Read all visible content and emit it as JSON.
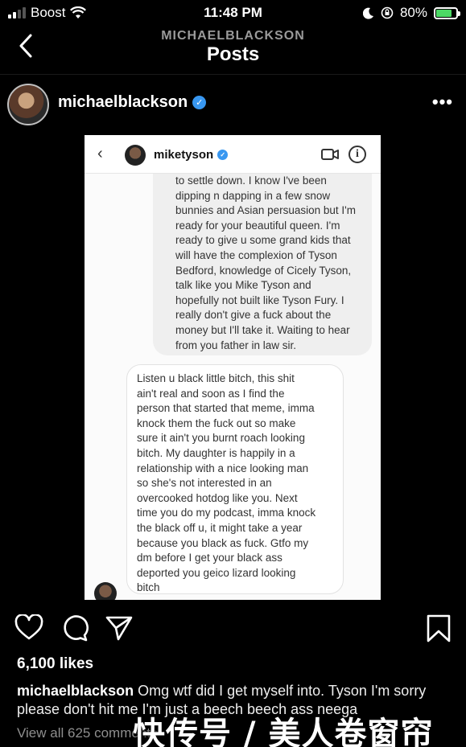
{
  "status_bar": {
    "carrier": "Boost",
    "time": "11:48 PM",
    "battery": "80%",
    "battery_level": 0.8
  },
  "header": {
    "account": "MICHAELBLACKSON",
    "title": "Posts"
  },
  "post": {
    "username": "michaelblackson",
    "more": "•••",
    "embedded": {
      "username": "miketyson",
      "info_icon": "i",
      "message_received": [
        "to settle down. I know I've been",
        "dipping n dapping in a few snow",
        "bunnies and Asian persuasion but I'm",
        "ready for your beautiful queen. I'm",
        "ready to give u some grand kids that",
        "will have the complexion of Tyson",
        "Bedford, knowledge of Cicely Tyson,",
        "talk like you Mike Tyson and",
        "hopefully not built like Tyson Fury. I",
        "really don't give a fuck about the",
        "money but I'll take it. Waiting to hear",
        "from you father in law sir."
      ],
      "message_reply": [
        "Listen u black little bitch, this shit",
        "ain't real and soon as I find the",
        "person that started that meme, imma",
        "knock them the fuck out so make",
        "sure it ain't you burnt roach looking",
        "bitch. My daughter is happily in a",
        "relationship with a nice looking man",
        "so she's not interested in an",
        "overcooked hotdog like you. Next",
        "time you do my podcast, imma knock",
        "the black off u, it might take a year",
        "because you black as fuck. Gtfo my",
        "dm before I get your black ass",
        "deported you geico lizard looking",
        "bitch"
      ]
    },
    "likes": "6,100 likes",
    "caption_user": "michaelblackson",
    "caption_text": "Omg wtf did I get myself into. Tyson I'm sorry please don't hit me I'm just a beech beech ass neega",
    "view_comments": "View all 625 comments"
  },
  "watermark": "快传号 / 美人卷窗帘",
  "colors": {
    "background": "#000000",
    "verified": "#3897f0",
    "battery_fill": "#4cd964",
    "muted": "#8e8e8e"
  },
  "icons": [
    "signal-icon",
    "wifi-icon",
    "moon-icon",
    "orientation-lock-icon",
    "battery-icon",
    "back-chevron-icon",
    "verified-badge-icon",
    "more-icon",
    "heart-icon",
    "comment-icon",
    "share-icon",
    "bookmark-icon",
    "video-call-icon",
    "info-icon"
  ]
}
